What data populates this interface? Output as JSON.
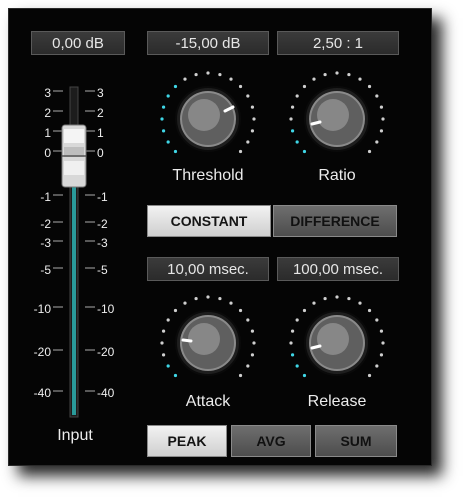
{
  "input": {
    "value": "0,00 dB",
    "label": "Input",
    "scale": [
      "3",
      "2",
      "1",
      "0",
      "-1",
      "-2",
      "-3",
      "-5",
      "-10",
      "-20",
      "-40"
    ]
  },
  "threshold": {
    "value": "-15,00 dB",
    "label": "Threshold"
  },
  "ratio": {
    "value": "2,50 : 1",
    "label": "Ratio"
  },
  "mode": {
    "constant_label": "CONSTANT",
    "difference_label": "DIFFERENCE",
    "active": "CONSTANT"
  },
  "attack": {
    "value": "10,00 msec.",
    "label": "Attack"
  },
  "release": {
    "value": "100,00 msec.",
    "label": "Release"
  },
  "detector": {
    "peak_label": "PEAK",
    "avg_label": "AVG",
    "sum_label": "SUM",
    "active": "PEAK"
  },
  "colors": {
    "active_dot": "#3fd6e6",
    "inactive_dot": "#cfcfcf",
    "meter": "#2a9a9a"
  }
}
